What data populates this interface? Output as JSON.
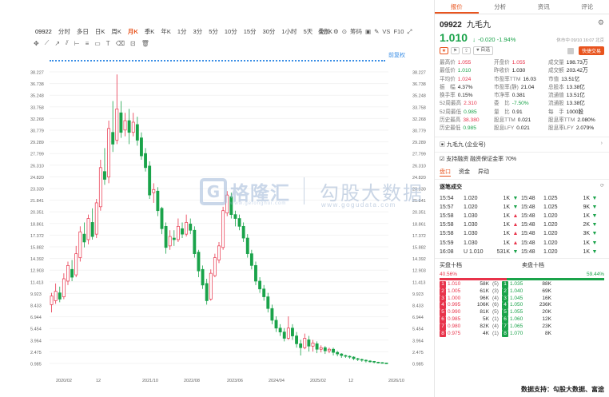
{
  "toolbar": {
    "code": "09922",
    "periods": [
      "分时",
      "多日",
      "日K",
      "周K",
      "月K",
      "季K",
      "年K",
      "1分",
      "3分",
      "5分",
      "10分",
      "15分",
      "30分",
      "1小时",
      "5天",
      "5分K"
    ],
    "tools": [
      "叠加",
      "筹码",
      "VS",
      "F10"
    ],
    "tag": "前复权"
  },
  "chart_data": {
    "type": "candlestick",
    "y_ticks": [
      "38.227",
      "36.738",
      "35.248",
      "33.758",
      "32.268",
      "30.779",
      "29.289",
      "27.799",
      "26.310",
      "24.820",
      "23.330",
      "21.841",
      "20.351",
      "18.861",
      "17.372",
      "15.882",
      "14.392",
      "12.903",
      "11.413",
      "9.923",
      "8.433",
      "6.944",
      "5.454",
      "3.964",
      "2.475",
      "0.985"
    ],
    "x_ticks": [
      "2020/02",
      "12",
      "2021/10",
      "2022/08",
      "2023/06",
      "2024/04",
      "2025/02",
      "12",
      "2026/10"
    ],
    "ylim": [
      0.985,
      38.227
    ],
    "candles": [
      [
        8.5,
        9.6,
        7.5,
        10.0
      ],
      [
        9.0,
        10.2,
        8.6,
        11.2
      ],
      [
        10.0,
        9.2,
        8.8,
        10.8
      ],
      [
        9.5,
        11.8,
        9.2,
        12.5
      ],
      [
        11.5,
        13.5,
        11.0,
        14.0
      ],
      [
        13.0,
        12.0,
        11.5,
        14.2
      ],
      [
        12.3,
        15.0,
        12.0,
        16.0
      ],
      [
        14.5,
        17.8,
        14.0,
        18.5
      ],
      [
        17.5,
        16.5,
        15.8,
        19.0
      ],
      [
        16.8,
        19.5,
        16.2,
        20.0
      ],
      [
        19.0,
        17.2,
        16.8,
        20.8
      ],
      [
        17.5,
        21.5,
        17.0,
        22.0
      ],
      [
        21.0,
        26.0,
        20.5,
        27.0
      ],
      [
        25.5,
        24.5,
        23.8,
        28.5
      ],
      [
        24.8,
        31.0,
        24.0,
        32.0
      ],
      [
        30.5,
        29.0,
        28.0,
        34.5
      ],
      [
        29.5,
        33.5,
        29.0,
        37.9
      ],
      [
        33.0,
        30.5,
        29.8,
        34.5
      ],
      [
        30.8,
        32.0,
        30.0,
        33.0
      ],
      [
        32.0,
        30.5,
        29.0,
        33.5
      ],
      [
        30.5,
        31.8,
        30.0,
        33.0
      ],
      [
        31.5,
        29.5,
        28.8,
        32.5
      ],
      [
        29.8,
        27.5,
        27.0,
        30.5
      ],
      [
        27.8,
        26.0,
        25.5,
        28.5
      ],
      [
        26.2,
        22.5,
        22.0,
        26.8
      ],
      [
        22.8,
        23.2,
        21.5,
        24.0
      ],
      [
        23.0,
        20.5,
        19.8,
        23.5
      ],
      [
        20.8,
        18.2,
        17.5,
        21.0
      ],
      [
        18.5,
        15.8,
        15.0,
        19.0
      ],
      [
        16.0,
        17.2,
        15.5,
        18.0
      ],
      [
        17.0,
        16.8,
        16.0,
        18.0
      ],
      [
        16.8,
        18.5,
        16.5,
        19.5
      ],
      [
        18.2,
        17.5,
        17.0,
        19.0
      ],
      [
        17.5,
        19.0,
        17.2,
        20.0
      ],
      [
        18.8,
        18.0,
        17.5,
        19.5
      ],
      [
        18.0,
        15.0,
        14.5,
        18.5
      ],
      [
        15.2,
        12.8,
        12.0,
        15.5
      ],
      [
        13.0,
        11.0,
        10.5,
        13.5
      ],
      [
        11.2,
        9.0,
        8.5,
        11.8
      ],
      [
        9.2,
        12.5,
        9.0,
        13.0
      ],
      [
        12.2,
        14.5,
        12.0,
        15.0
      ],
      [
        14.2,
        16.0,
        13.8,
        16.5
      ],
      [
        15.8,
        20.5,
        15.5,
        21.0
      ],
      [
        20.2,
        22.5,
        19.8,
        23.0
      ],
      [
        22.3,
        20.0,
        19.5,
        22.8
      ],
      [
        20.0,
        19.5,
        18.5,
        20.5
      ],
      [
        19.5,
        18.5,
        18.0,
        20.0
      ],
      [
        18.5,
        17.0,
        16.5,
        19.0
      ],
      [
        17.0,
        15.0,
        14.5,
        17.5
      ],
      [
        15.0,
        13.5,
        13.0,
        15.5
      ],
      [
        13.5,
        11.5,
        11.0,
        14.0
      ],
      [
        11.5,
        10.5,
        10.0,
        12.0
      ],
      [
        10.5,
        9.5,
        9.0,
        11.0
      ],
      [
        9.5,
        8.0,
        7.5,
        10.0
      ],
      [
        8.0,
        6.5,
        6.0,
        8.5
      ],
      [
        6.5,
        5.5,
        5.0,
        7.0
      ],
      [
        5.5,
        5.0,
        4.5,
        6.0
      ],
      [
        5.0,
        4.2,
        3.8,
        5.5
      ],
      [
        4.2,
        5.5,
        4.0,
        7.0
      ],
      [
        5.5,
        4.5,
        4.0,
        6.0
      ],
      [
        4.5,
        3.5,
        3.0,
        5.0
      ],
      [
        3.5,
        3.0,
        2.0,
        4.0
      ],
      [
        3.0,
        4.2,
        2.8,
        4.8
      ],
      [
        4.0,
        3.2,
        2.5,
        4.5
      ],
      [
        3.2,
        3.6,
        2.5,
        4.0
      ],
      [
        3.5,
        2.8,
        2.3,
        3.8
      ],
      [
        2.8,
        3.0,
        2.4,
        3.3
      ],
      [
        3.0,
        2.6,
        2.2,
        3.2
      ],
      [
        2.6,
        2.8,
        2.3,
        3.0
      ],
      [
        2.8,
        2.4,
        2.0,
        3.0
      ],
      [
        2.4,
        2.2,
        1.9,
        2.6
      ],
      [
        2.2,
        2.0,
        1.7,
        2.3
      ],
      [
        2.0,
        1.9,
        1.7,
        2.1
      ],
      [
        1.9,
        1.8,
        1.6,
        2.0
      ],
      [
        1.8,
        1.6,
        1.4,
        1.9
      ],
      [
        1.6,
        1.5,
        1.3,
        1.7
      ],
      [
        1.5,
        1.4,
        1.2,
        1.6
      ],
      [
        1.4,
        1.3,
        1.1,
        1.5
      ],
      [
        1.3,
        1.25,
        1.1,
        1.4
      ],
      [
        1.25,
        1.15,
        1.0,
        1.3
      ],
      [
        1.15,
        1.1,
        1.0,
        1.2
      ],
      [
        1.1,
        1.05,
        0.99,
        1.15
      ],
      [
        1.05,
        1.01,
        0.985,
        1.08
      ]
    ]
  },
  "watermark": {
    "brand": "格隆汇",
    "brand_sub": "www.gelonghui.com",
    "brand2": "勾股大数据",
    "brand2_sub": "www.gogudata.com"
  },
  "panel": {
    "tabs": [
      "报价",
      "分析",
      "资讯",
      "评论"
    ],
    "code": "09922",
    "name": "九毛九",
    "price": "1.010",
    "change": "-0.020 -1.94%",
    "time": "休市中 09/10 16:07 北京",
    "self_label": "自选",
    "quick": "快捷交易",
    "stats": [
      [
        "最高价",
        "1.055",
        "red",
        "开盘价",
        "1.055",
        "red",
        "成交量",
        "198.73万",
        "blk"
      ],
      [
        "最低价",
        "1.010",
        "grn",
        "昨收价",
        "1.030",
        "blk",
        "成交额",
        "203.42万",
        "blk"
      ],
      [
        "平均价",
        "1.024",
        "red",
        "市盈率TTM",
        "16.03",
        "blk",
        "市值",
        "13.51亿",
        "blk"
      ],
      [
        "振　幅",
        "4.37%",
        "blk",
        "市盈率(静)",
        "21.04",
        "blk",
        "总股本",
        "13.38亿",
        "blk"
      ],
      [
        "换手率",
        "0.15%",
        "blk",
        "市净率",
        "0.381",
        "blk",
        "流通值",
        "13.51亿",
        "blk"
      ],
      [
        "52周最高",
        "2.310",
        "red",
        "委　比",
        "-7.50%",
        "grn",
        "流通股",
        "13.38亿",
        "blk"
      ],
      [
        "52周最低",
        "0.985",
        "grn",
        "量　比",
        "0.91",
        "blk",
        "每　手",
        "1000股",
        "blk"
      ],
      [
        "历史最高",
        "38.380",
        "red",
        "股息TTM",
        "0.021",
        "blk",
        "股息率TTM",
        "2.080%",
        "blk"
      ],
      [
        "历史最低",
        "0.985",
        "grn",
        "股息LFY",
        "0.021",
        "blk",
        "股息率LFY",
        "2.079%",
        "blk"
      ]
    ],
    "company": "九毛九 (企业号)",
    "margin": "支持融资 融资保证金率 70%",
    "subtabs": [
      "盘口",
      "资金",
      "异动"
    ],
    "deals_title": "逐笔成交",
    "deals_icon": "⟳",
    "deals": [
      [
        "15:54",
        "1.020",
        "1K",
        "▼",
        "15:48",
        "1.025",
        "1K",
        "▼"
      ],
      [
        "15:57",
        "1.020",
        "1K",
        "▼",
        "15:48",
        "1.025",
        "9K",
        "▼"
      ],
      [
        "15:58",
        "1.030",
        "1K",
        "▲",
        "15:48",
        "1.020",
        "1K",
        "▼"
      ],
      [
        "15:58",
        "1.030",
        "1K",
        "▲",
        "15:48",
        "1.020",
        "2K",
        "▼"
      ],
      [
        "15:58",
        "1.030",
        "1K",
        "▲",
        "15:48",
        "1.020",
        "3K",
        "▼"
      ],
      [
        "15:59",
        "1.030",
        "1K",
        "▲",
        "15:48",
        "1.020",
        "1K",
        "▼"
      ],
      [
        "16:08",
        "U 1.010",
        "531K",
        "▼",
        "15:48",
        "1.020",
        "1K",
        "▼"
      ]
    ],
    "book_buy": "买盘十档",
    "book_sell": "卖盘十档",
    "buy_pct": "40.56%",
    "sell_pct": "59.44%",
    "buy_ratio": 40.56,
    "book": [
      [
        "1",
        "1.010",
        "58K",
        "(5)",
        "1",
        "1.035",
        "88K"
      ],
      [
        "2",
        "1.005",
        "61K",
        "(3)",
        "2",
        "1.040",
        "69K"
      ],
      [
        "3",
        "1.000",
        "96K",
        "(4)",
        "3",
        "1.045",
        "16K"
      ],
      [
        "4",
        "0.995",
        "106K",
        "(6)",
        "4",
        "1.050",
        "236K"
      ],
      [
        "5",
        "0.990",
        "81K",
        "(5)",
        "5",
        "1.055",
        "20K"
      ],
      [
        "6",
        "0.985",
        "5K",
        "(1)",
        "6",
        "1.060",
        "12K"
      ],
      [
        "7",
        "0.980",
        "82K",
        "(4)",
        "7",
        "1.065",
        "23K"
      ],
      [
        "8",
        "0.975",
        "4K",
        "(1)",
        "8",
        "1.070",
        "8K"
      ]
    ]
  },
  "footer": "数据支持：勾股大数据、富途"
}
